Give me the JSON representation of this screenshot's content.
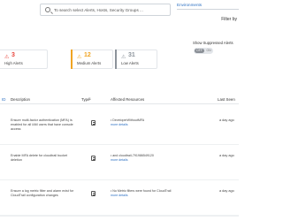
{
  "search": {
    "placeholder": "To search select Alerts, Hosts, Security Groups ..."
  },
  "header": {
    "environments_label": "Environments",
    "filter_by": "Filter by"
  },
  "cards": {
    "high": {
      "count": "3",
      "label": "High Alerts",
      "color": "#e8453c",
      "icon": "warning-icon"
    },
    "medium": {
      "count": "12",
      "label": "Medium Alerts",
      "color": "#f0a422",
      "icon": "warning-icon"
    },
    "low": {
      "count": "31",
      "label": "Low Alerts",
      "color": "#8c939b",
      "icon": "warning-icon"
    }
  },
  "suppressed": {
    "label": "Show Suppressed Alerts",
    "on_label": "OFF",
    "off_label": "ON"
  },
  "table": {
    "headers": {
      "id": "ID",
      "description": "Description",
      "type": "Type",
      "affected": "Affected Resources",
      "last_seen": "Last Seen"
    },
    "rows": [
      {
        "description": "Ensure multi-factor authentication (MFA) is enabled for all IAM users that have console access",
        "resource": "• DeveloperWithoutMFA",
        "more": "more details",
        "last_seen": "a day ago"
      },
      {
        "description": "Enable MFA delete for cloudtrail bucket deletion",
        "resource": "• and cloudtrail-791986549120",
        "more": "more details",
        "last_seen": "a day ago"
      },
      {
        "description": "Ensure a log metric filter and alarm exist for CloudTrail configuration changes",
        "resource": "• No Metric filters were found for CloudTrail",
        "more": "more details",
        "last_seen": "a day ago"
      }
    ]
  }
}
